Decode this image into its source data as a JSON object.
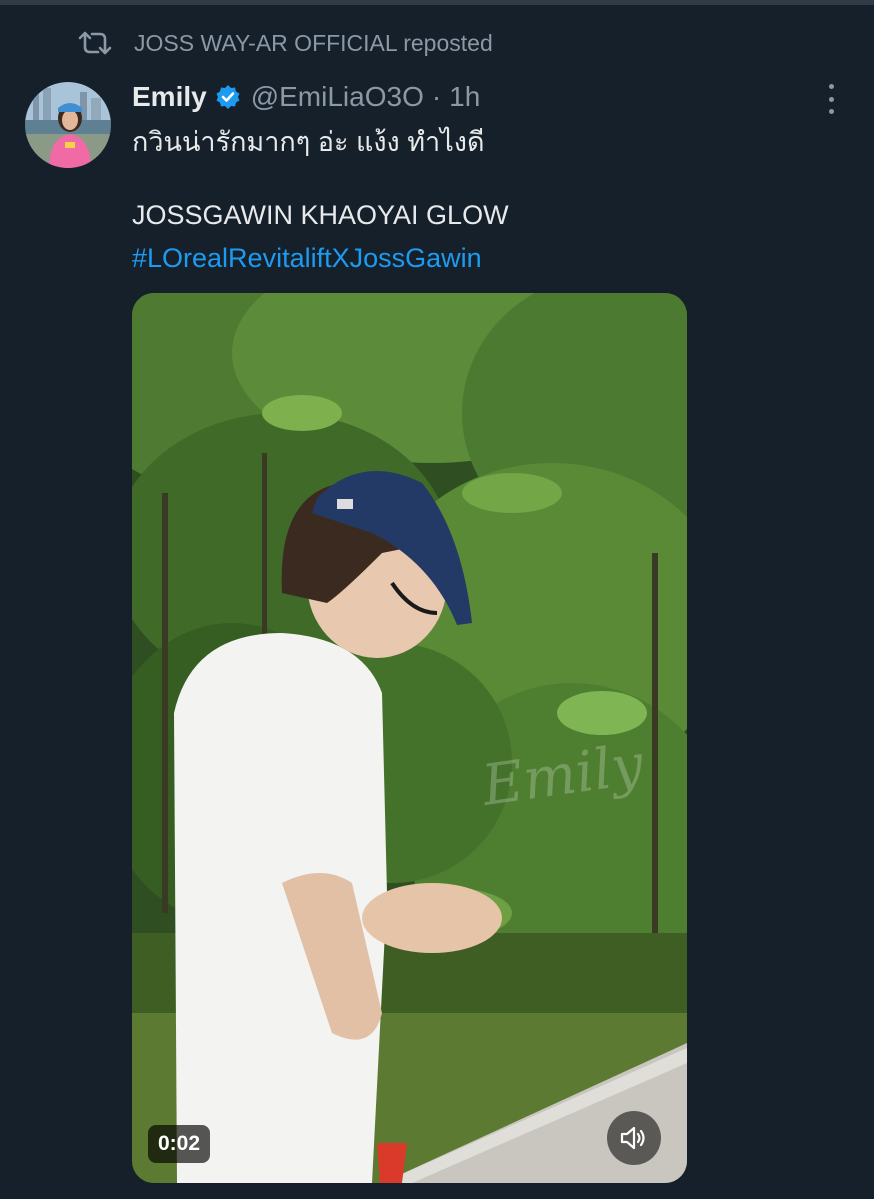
{
  "repost": {
    "icon": "repost-icon",
    "text": "JOSS WAY-AR OFFICIAL reposted"
  },
  "tweet": {
    "display_name": "Emily",
    "verified_icon": "verified-badge-icon",
    "handle": "@EmiLiaO3O",
    "separator": "·",
    "time": "1h",
    "text_line1": "กวินน่ารักมากๆ อ่ะ แง้ง ทำไงดี",
    "text_line2": "JOSSGAWIN KHAOYAI GLOW",
    "hashtag": "#LOrealRevitaliftXJossGawin"
  },
  "media": {
    "duration": "0:02",
    "watermark": "Emily",
    "mute_icon": "volume-muted-icon"
  },
  "colors": {
    "background": "#15202b",
    "text": "#e7e9ea",
    "secondary": "#8b98a5",
    "link": "#1d9bf0"
  }
}
